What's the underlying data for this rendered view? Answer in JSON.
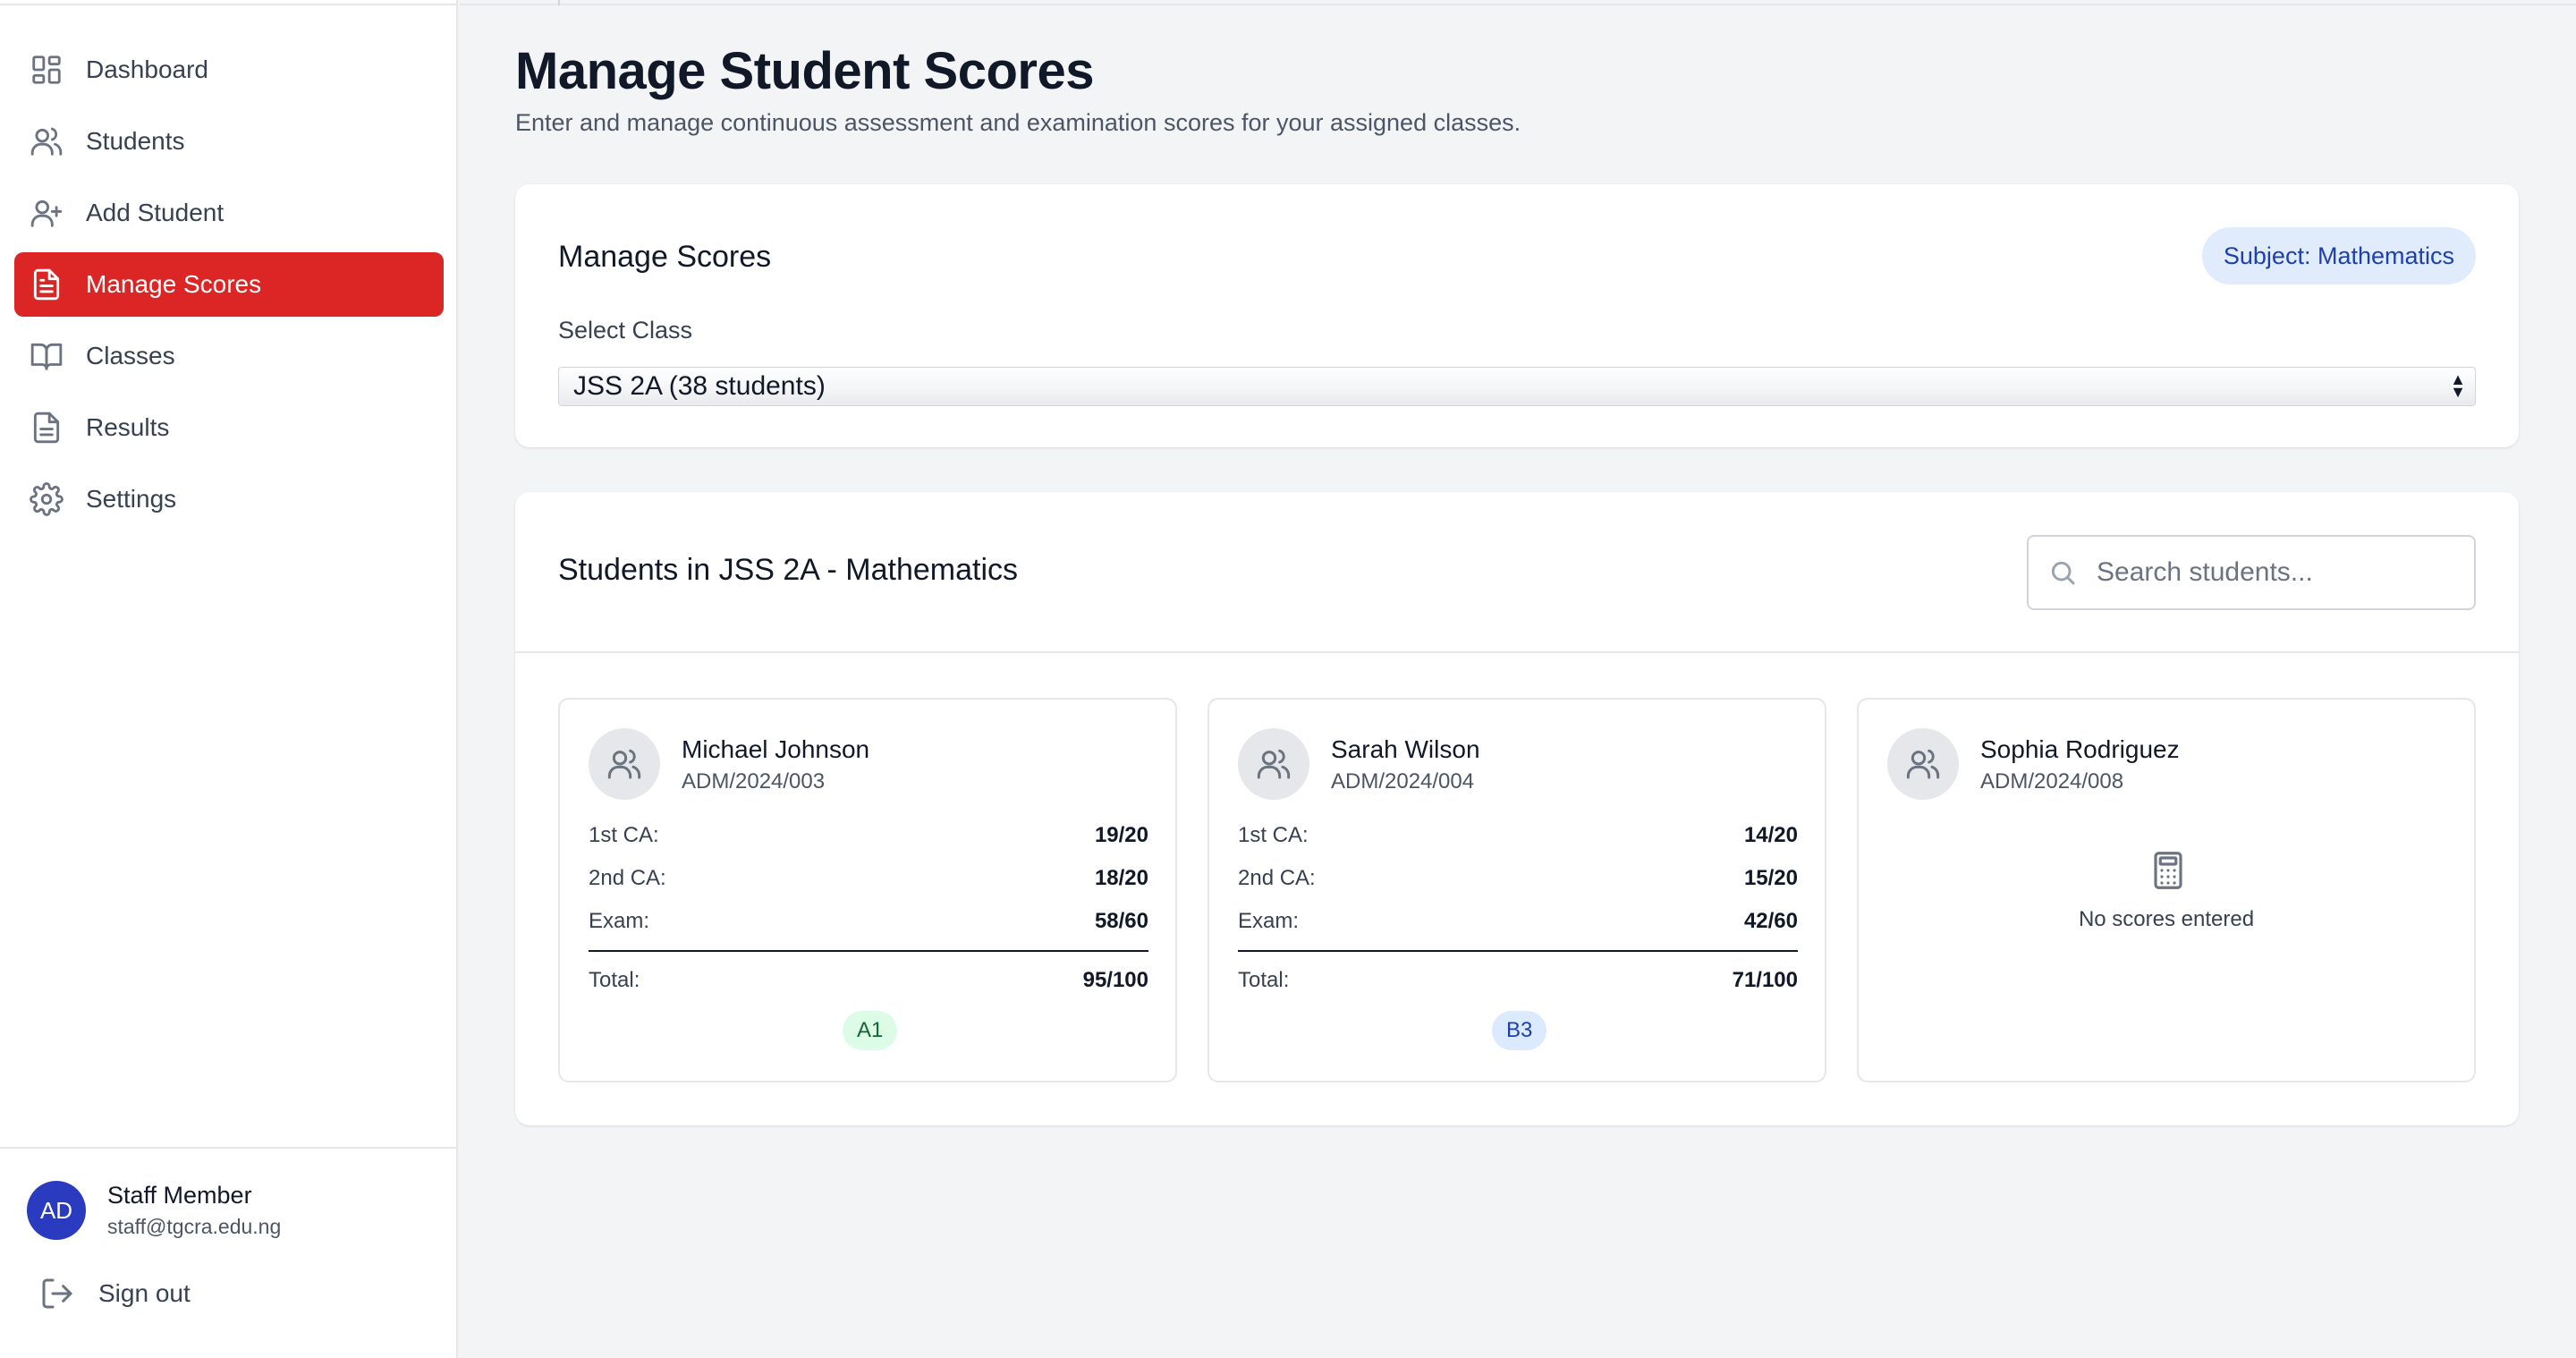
{
  "sidebar": {
    "items": [
      {
        "label": "Dashboard",
        "icon": "dashboard-icon"
      },
      {
        "label": "Students",
        "icon": "users-icon"
      },
      {
        "label": "Add Student",
        "icon": "user-plus-icon"
      },
      {
        "label": "Manage Scores",
        "icon": "document-icon",
        "active": true
      },
      {
        "label": "Classes",
        "icon": "book-icon"
      },
      {
        "label": "Results",
        "icon": "file-text-icon"
      },
      {
        "label": "Settings",
        "icon": "gear-icon"
      }
    ],
    "user": {
      "initials": "AD",
      "name": "Staff Member",
      "email": "staff@tgcra.edu.ng"
    },
    "signout_label": "Sign out"
  },
  "page": {
    "title": "Manage Student Scores",
    "subtitle": "Enter and manage continuous assessment and examination scores for your assigned classes."
  },
  "manage_card": {
    "title": "Manage Scores",
    "subject_badge": "Subject: Mathematics",
    "select_label": "Select Class",
    "selected_class": "JSS 2A (38 students)"
  },
  "students_card": {
    "title": "Students in JSS 2A - Mathematics",
    "search_placeholder": "Search students...",
    "labels": {
      "ca1": "1st CA:",
      "ca2": "2nd CA:",
      "exam": "Exam:",
      "total": "Total:"
    },
    "students": [
      {
        "name": "Michael Johnson",
        "adm": "ADM/2024/003",
        "ca1": "19/20",
        "ca2": "18/20",
        "exam": "58/60",
        "total": "95/100",
        "grade": "A1"
      },
      {
        "name": "Sarah Wilson",
        "adm": "ADM/2024/004",
        "ca1": "14/20",
        "ca2": "15/20",
        "exam": "42/60",
        "total": "71/100",
        "grade": "B3"
      },
      {
        "name": "Sophia Rodriguez",
        "adm": "ADM/2024/008",
        "empty_text": "No scores entered"
      }
    ]
  },
  "colors": {
    "accent": "#dc2626",
    "avatar": "#2a3bbf",
    "grade_a_bg": "#dcfce7",
    "grade_b_bg": "#dbeafe",
    "badge_bg": "#e0ecfb"
  }
}
